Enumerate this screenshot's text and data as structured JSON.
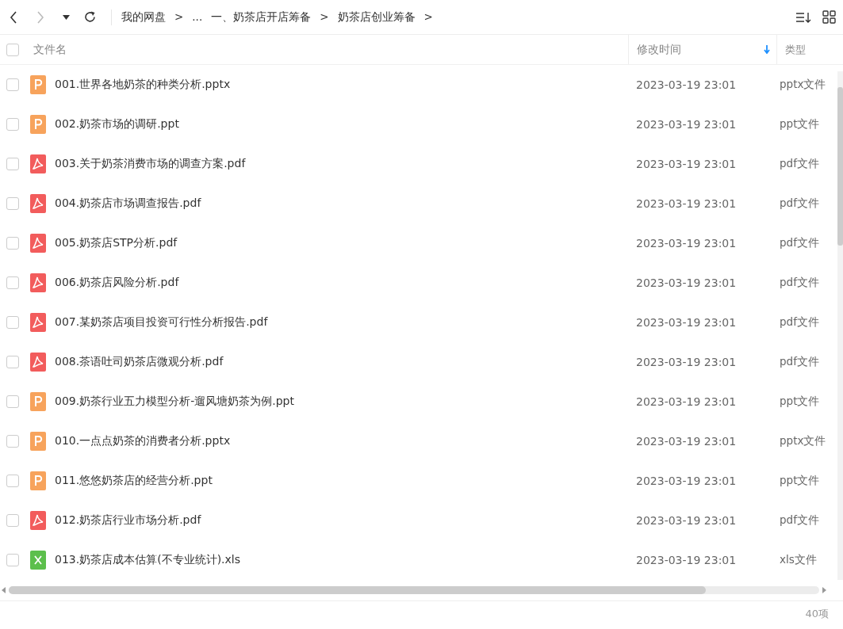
{
  "breadcrumb": [
    "我的网盘",
    ">",
    "...",
    "一、奶茶店开店筹备",
    ">",
    "奶茶店创业筹备",
    ">"
  ],
  "table": {
    "select_all": {
      "checked": false
    },
    "columns": [
      "文件名",
      "修改时间",
      "类型"
    ],
    "rows": [
      {
        "kind": "ppt",
        "name": "001.世界各地奶茶的种类分析.pptx",
        "modified": "2023-03-19 23:01",
        "type": "pptx文件",
        "selected": false
      },
      {
        "kind": "ppt",
        "name": "002.奶茶市场的调研.ppt",
        "modified": "2023-03-19 23:01",
        "type": "ppt文件",
        "selected": false
      },
      {
        "kind": "pdf",
        "name": "003.关于奶茶消费市场的调查方案.pdf",
        "modified": "2023-03-19 23:01",
        "type": "pdf文件",
        "selected": false
      },
      {
        "kind": "pdf",
        "name": "004.奶茶店市场调查报告.pdf",
        "modified": "2023-03-19 23:01",
        "type": "pdf文件",
        "selected": false
      },
      {
        "kind": "pdf",
        "name": "005.奶茶店STP分析.pdf",
        "modified": "2023-03-19 23:01",
        "type": "pdf文件",
        "selected": false
      },
      {
        "kind": "pdf",
        "name": "006.奶茶店风险分析.pdf",
        "modified": "2023-03-19 23:01",
        "type": "pdf文件",
        "selected": false
      },
      {
        "kind": "pdf",
        "name": "007.某奶茶店项目投资可行性分析报告.pdf",
        "modified": "2023-03-19 23:01",
        "type": "pdf文件",
        "selected": false
      },
      {
        "kind": "pdf",
        "name": "008.茶语吐司奶茶店微观分析.pdf",
        "modified": "2023-03-19 23:01",
        "type": "pdf文件",
        "selected": false
      },
      {
        "kind": "ppt",
        "name": "009.奶茶行业五力模型分析-遛风塘奶茶为例.ppt",
        "modified": "2023-03-19 23:01",
        "type": "ppt文件",
        "selected": false
      },
      {
        "kind": "ppt",
        "name": "010.一点点奶茶的消费者分析.pptx",
        "modified": "2023-03-19 23:01",
        "type": "pptx文件",
        "selected": false
      },
      {
        "kind": "ppt",
        "name": "011.悠悠奶茶店的经营分析.ppt",
        "modified": "2023-03-19 23:01",
        "type": "ppt文件",
        "selected": false
      },
      {
        "kind": "pdf",
        "name": "012.奶茶店行业市场分析.pdf",
        "modified": "2023-03-19 23:01",
        "type": "pdf文件",
        "selected": false
      },
      {
        "kind": "xls",
        "name": "013.奶茶店成本估算(不专业统计).xls",
        "modified": "2023-03-19 23:01",
        "type": "xls文件",
        "selected": false
      }
    ]
  },
  "status_bar": {
    "count": "40项"
  }
}
